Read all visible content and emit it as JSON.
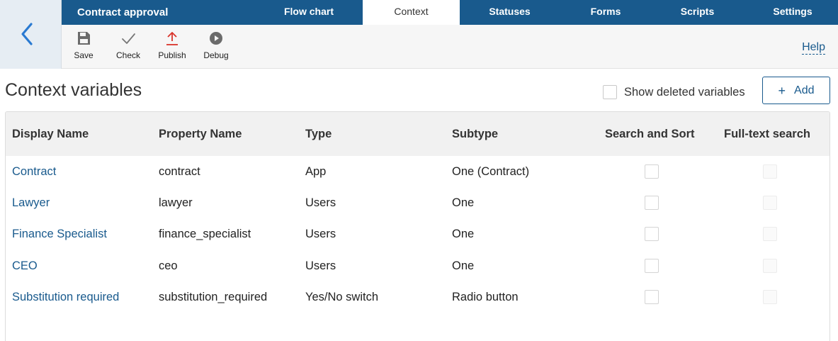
{
  "app": {
    "title": "Contract approval",
    "back_icon": "chevron-left-icon"
  },
  "tabs": [
    {
      "label": "Flow chart",
      "active": false
    },
    {
      "label": "Context",
      "active": true
    },
    {
      "label": "Statuses",
      "active": false
    },
    {
      "label": "Forms",
      "active": false
    },
    {
      "label": "Scripts",
      "active": false
    },
    {
      "label": "Settings",
      "active": false
    }
  ],
  "toolbar": {
    "save_label": "Save",
    "check_label": "Check",
    "publish_label": "Publish",
    "debug_label": "Debug",
    "help_label": "Help"
  },
  "page": {
    "title": "Context variables",
    "show_deleted_label": "Show deleted variables",
    "show_deleted_checked": false,
    "add_label": "Add"
  },
  "table": {
    "headers": [
      "Display Name",
      "Property Name",
      "Type",
      "Subtype",
      "Search and Sort",
      "Full-text search"
    ],
    "rows": [
      {
        "display_name": "Contract",
        "property_name": "contract",
        "type": "App",
        "subtype": "One (Contract)",
        "search_sort": false,
        "full_text": false
      },
      {
        "display_name": "Lawyer",
        "property_name": "lawyer",
        "type": "Users",
        "subtype": "One",
        "search_sort": false,
        "full_text": false
      },
      {
        "display_name": "Finance Specialist",
        "property_name": "finance_specialist",
        "type": "Users",
        "subtype": "One",
        "search_sort": false,
        "full_text": false
      },
      {
        "display_name": "CEO",
        "property_name": "ceo",
        "type": "Users",
        "subtype": "One",
        "search_sort": false,
        "full_text": false
      },
      {
        "display_name": "Substitution required",
        "property_name": "substitution_required",
        "type": "Yes/No switch",
        "subtype": "Radio button",
        "search_sort": false,
        "full_text": false
      }
    ]
  },
  "colors": {
    "brand": "#195a8d",
    "publish_accent": "#d9342b"
  }
}
